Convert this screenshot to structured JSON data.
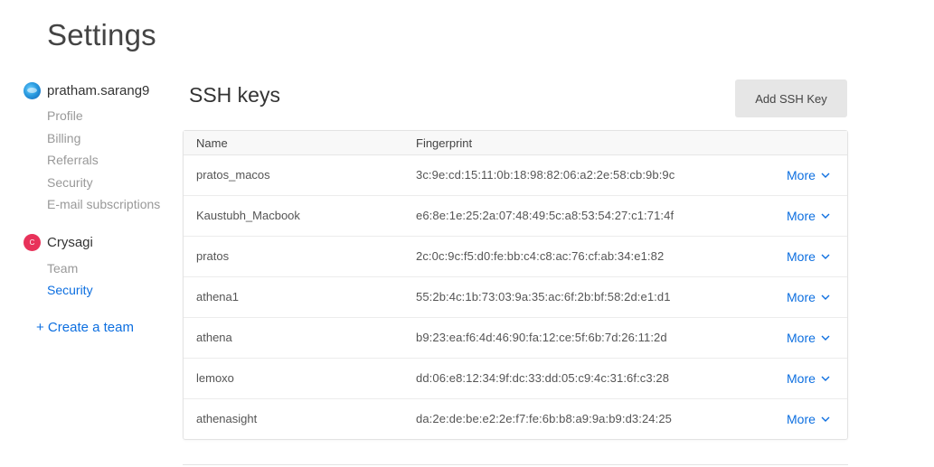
{
  "page": {
    "title": "Settings"
  },
  "sidebar": {
    "user": {
      "name": "pratham.sarang9",
      "items": [
        "Profile",
        "Billing",
        "Referrals",
        "Security",
        "E-mail subscriptions"
      ]
    },
    "team": {
      "initial": "C",
      "name": "Crysagi",
      "items": [
        "Team",
        "Security"
      ],
      "active_item": "Security"
    },
    "create_team": "+ Create a team"
  },
  "main": {
    "title": "SSH keys",
    "add_button": "Add SSH Key",
    "columns": {
      "name": "Name",
      "fingerprint": "Fingerprint"
    },
    "more_label": "More",
    "keys": [
      {
        "name": "pratos_macos",
        "fingerprint": "3c:9e:cd:15:11:0b:18:98:82:06:a2:2e:58:cb:9b:9c"
      },
      {
        "name": "Kaustubh_Macbook",
        "fingerprint": "e6:8e:1e:25:2a:07:48:49:5c:a8:53:54:27:c1:71:4f"
      },
      {
        "name": "pratos",
        "fingerprint": "2c:0c:9c:f5:d0:fe:bb:c4:c8:ac:76:cf:ab:34:e1:82"
      },
      {
        "name": "athena1",
        "fingerprint": "55:2b:4c:1b:73:03:9a:35:ac:6f:2b:bf:58:2d:e1:d1"
      },
      {
        "name": "athena",
        "fingerprint": "b9:23:ea:f6:4d:46:90:fa:12:ce:5f:6b:7d:26:11:2d"
      },
      {
        "name": "lemoxo",
        "fingerprint": "dd:06:e8:12:34:9f:dc:33:dd:05:c9:4c:31:6f:c3:28"
      },
      {
        "name": "athenasight",
        "fingerprint": "da:2e:de:be:e2:2e:f7:fe:6b:b8:a9:9a:b9:d3:24:25"
      }
    ]
  },
  "colors": {
    "accent": "#0d6fe0",
    "team_avatar": "#e8325a",
    "button_bg": "#e6e6e6"
  },
  "icons": {
    "user_avatar": "globe-avatar-icon",
    "more": "chevron-down-icon"
  }
}
